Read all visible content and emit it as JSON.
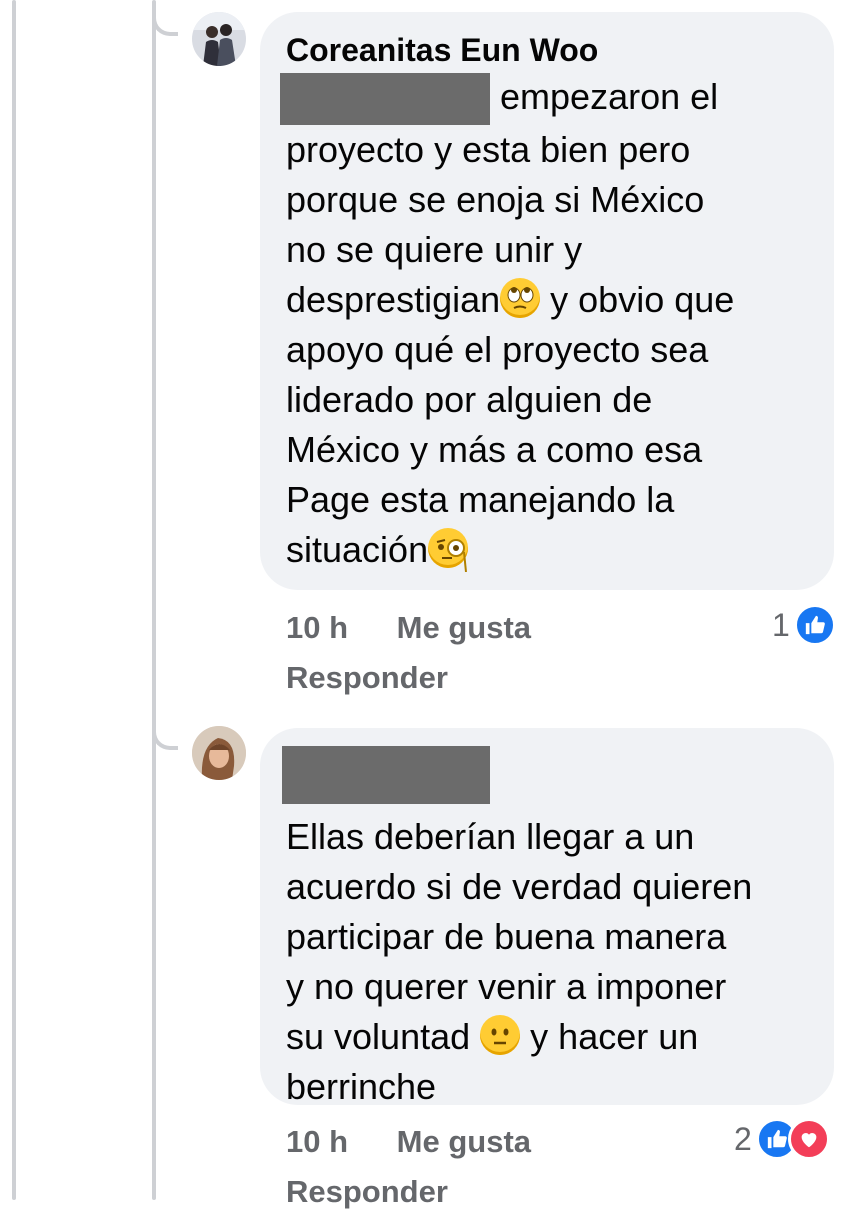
{
  "comments": [
    {
      "author": "Coreanitas Eun Woo",
      "text_lines": [
        "empezaron el",
        "proyecto y esta bien pero",
        "porque se enoja si México",
        "no se quiere unir y",
        "desprestigian",
        "y obvio que",
        "apoyo qué el proyecto sea",
        "liderado por alguien de",
        "México y más a como esa",
        "Page esta manejando la",
        "situación"
      ],
      "time": "10 h",
      "like_label": "Me gusta",
      "reply_label": "Responder",
      "reaction_count": "1",
      "emoji": [
        "face-with-rolling-eyes",
        "face-with-monocle"
      ]
    },
    {
      "author": "",
      "text_lines": [
        "Ellas deberían llegar a un",
        "acuerdo si de verdad quieren",
        "participar de buena manera",
        "y no querer venir a imponer",
        "su voluntad",
        "y hacer un",
        "berrinche"
      ],
      "time": "10 h",
      "like_label": "Me gusta",
      "reply_label": "Responder",
      "reaction_count": "2",
      "emoji": [
        "neutral-face"
      ]
    }
  ],
  "colors": {
    "bubble": "#f0f2f5",
    "meta": "#65676b",
    "mention": "#1877f2",
    "like": "#1877f2",
    "love": "#f33e58",
    "thread_line": "#ced0d4"
  }
}
